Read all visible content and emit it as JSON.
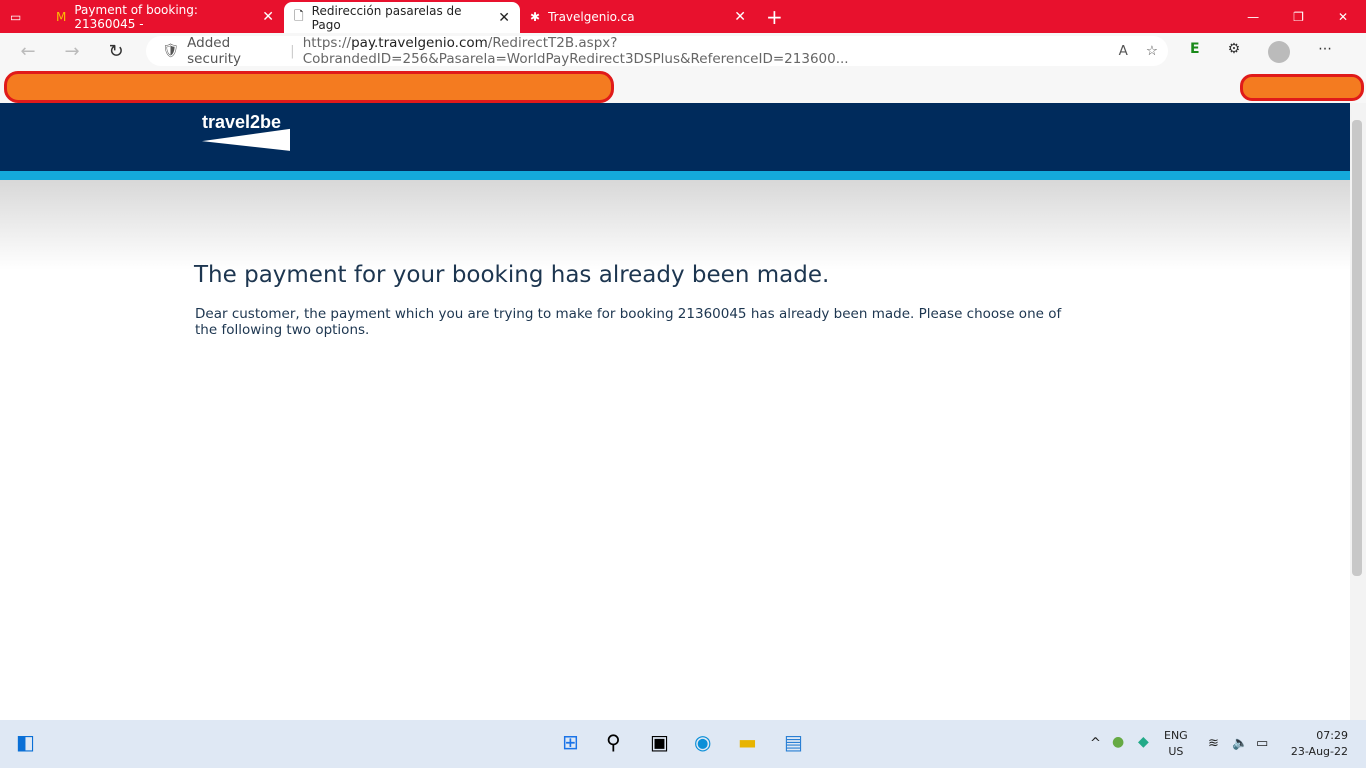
{
  "tabs": [
    {
      "label": "Payment of booking: 21360045 -"
    },
    {
      "label": "Redirección pasarelas de Pago"
    },
    {
      "label": "Travelgenio.ca"
    }
  ],
  "address": {
    "security": "Added security",
    "url_prefix": "https://",
    "url_domain": "pay.travelgenio.com",
    "url_rest": "/RedirectT2B.aspx?CobrandedID=256&Pasarela=WorldPayRedirect3DSPlus&ReferenceID=213600..."
  },
  "logo": "travel2be",
  "page": {
    "title": "The payment for your booking has already been made.",
    "message": "Dear customer, the payment which you are trying to make for booking 21360045 has already been made. Please choose one of the following two options."
  },
  "tray": {
    "lang": "ENG",
    "region": "US",
    "time": "07:29",
    "date": "23-Aug-22"
  },
  "colors": {
    "tabbar": "#e8112d",
    "header": "#002b5c",
    "stripe": "#14a9db"
  }
}
